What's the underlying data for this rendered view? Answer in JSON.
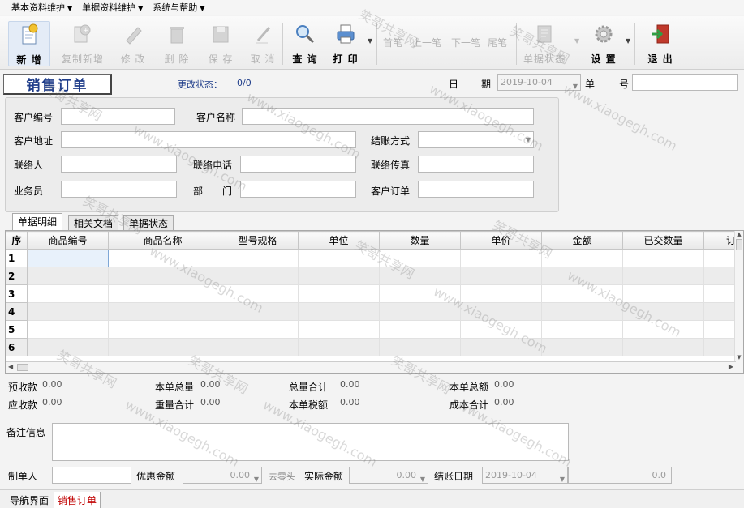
{
  "menu": [
    {
      "label": "基本资料维护"
    },
    {
      "label": "单据资料维护"
    },
    {
      "label": "系统与帮助"
    }
  ],
  "toolbar": {
    "new": "新 增",
    "copy_new": "复制新增",
    "edit": "修 改",
    "delete": "删 除",
    "save": "保 存",
    "cancel": "取 消",
    "query": "查 询",
    "print": "打 印",
    "first": "首笔",
    "prev": "上一笔",
    "next": "下一笔",
    "last": "尾笔",
    "doc_status": "单据状态",
    "settings": "设 置",
    "exit": "退 出"
  },
  "form": {
    "title": "销售订单",
    "change_status_label": "更改状态：",
    "change_status_value": "0/0",
    "date_label": "日",
    "date_label2": "期",
    "date_value": "2019-10-04",
    "order_no_label": "单",
    "order_no_label2": "号",
    "customer_code": "客户编号",
    "customer_name": "客户名称",
    "customer_address": "客户地址",
    "settlement_method": "结账方式",
    "contact": "联络人",
    "contact_phone": "联络电话",
    "contact_fax": "联络传真",
    "salesman": "业务员",
    "department_label": "部",
    "department_label2": "门",
    "customer_order": "客户订单"
  },
  "tabs": [
    "单据明细",
    "相关文档",
    "单据状态"
  ],
  "grid": {
    "columns": [
      "序",
      "商品编号",
      "商品名称",
      "型号规格",
      "单位",
      "数量",
      "单价",
      "金额",
      "已交数量",
      "订"
    ],
    "rows": [
      "1",
      "2",
      "3",
      "4",
      "5",
      "6"
    ]
  },
  "summary": {
    "prepaid_label": "预收款",
    "prepaid_value": "0.00",
    "receivable_label": "应收款",
    "receivable_value": "0.00",
    "total_qty_label": "本单总量",
    "total_qty_value": "0.00",
    "weight_total_label": "重量合计",
    "weight_total_value": "0.00",
    "sum_qty_label": "总量合计",
    "sum_qty_value": "0.00",
    "tax_label": "本单税额",
    "tax_value": "0.00",
    "total_amount_label": "本单总额",
    "total_amount_value": "0.00",
    "cost_total_label": "成本合计",
    "cost_total_value": "0.00"
  },
  "footer": {
    "remark_label": "备注信息",
    "maker_label": "制单人",
    "discount_label": "优惠金额",
    "discount_value": "0.00",
    "round_label": "去零头",
    "actual_label": "实际金额",
    "actual_value": "0.00",
    "settle_date_label": "结账日期",
    "settle_date_value": "2019-10-04",
    "extra_value": "0.0"
  },
  "status_tabs": [
    "导航界面",
    "销售订单"
  ],
  "watermark": {
    "cn": "笑哥共享网",
    "url": "www.xiaogegh.com"
  },
  "colors": {
    "title_blue": "#1f3d8a",
    "active_tab_red": "#c00000",
    "selected_cell": "#e8f1fb"
  }
}
